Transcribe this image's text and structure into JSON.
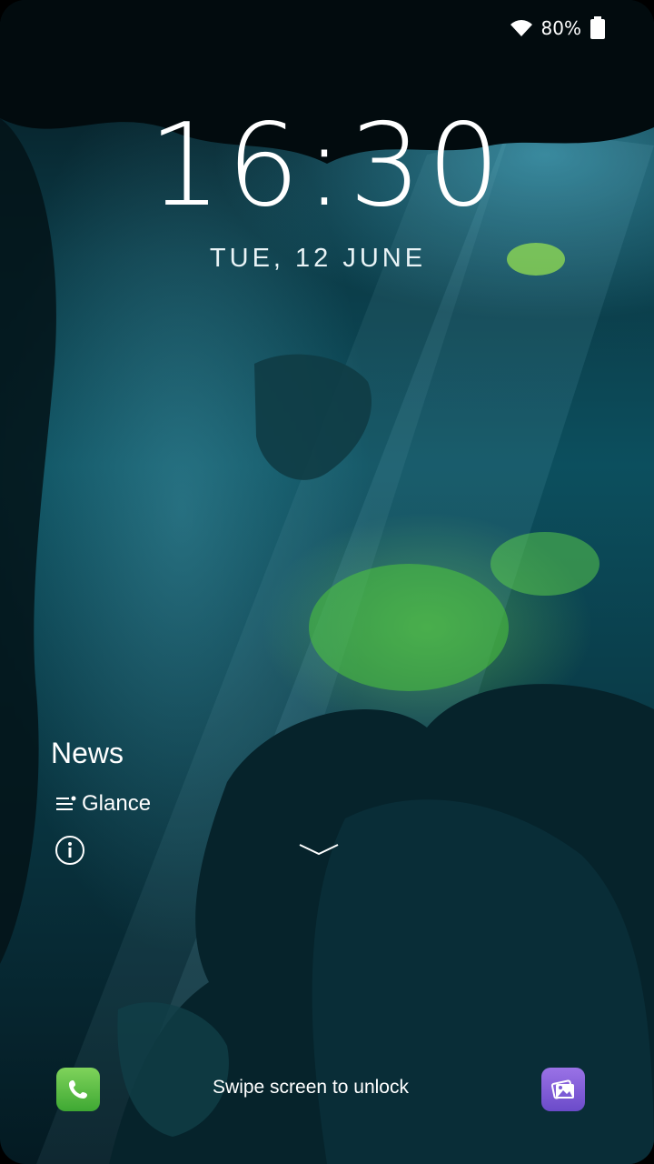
{
  "status_bar": {
    "battery_percent": "80%",
    "icons": [
      "wifi-icon",
      "battery-icon"
    ]
  },
  "lockscreen": {
    "time": "16:30",
    "date": "TUE, 12 JUNE",
    "news_title": "News",
    "glance_label": "Glance",
    "unlock_hint": "Swipe screen to unlock"
  },
  "shortcuts": {
    "left": "phone-icon",
    "right": "gallery-icon"
  },
  "colors": {
    "phone_app": "#5cc045",
    "gallery_app": "#7b5bd6",
    "text": "#ffffff"
  }
}
